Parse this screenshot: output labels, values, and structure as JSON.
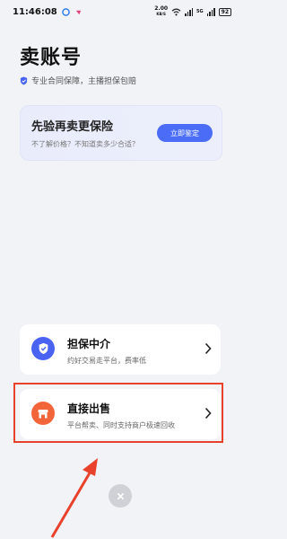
{
  "status_bar": {
    "time": "11:46:08",
    "speed_value": "2.00",
    "speed_unit": "KB/S",
    "signal_label": "5G",
    "battery": "92"
  },
  "page": {
    "title": "卖账号",
    "subtitle": "专业合同保障，主播担保包赔"
  },
  "promo": {
    "title": "先验再卖更保险",
    "subtitle": "不了解价格？不知道卖多少合适？",
    "button_label": "立即鉴定"
  },
  "options": [
    {
      "title": "担保中介",
      "subtitle": "约好交易走平台，费率低",
      "icon": "shield-check-icon",
      "icon_color": "#4a63f2"
    },
    {
      "title": "直接出售",
      "subtitle": "平台帮卖、同时支持商户极速回收",
      "icon": "store-icon",
      "icon_color": "#f2653a"
    }
  ],
  "colors": {
    "accent": "#4a6cf7",
    "annotation_red": "#e8412c",
    "background": "#f2f3f7"
  }
}
